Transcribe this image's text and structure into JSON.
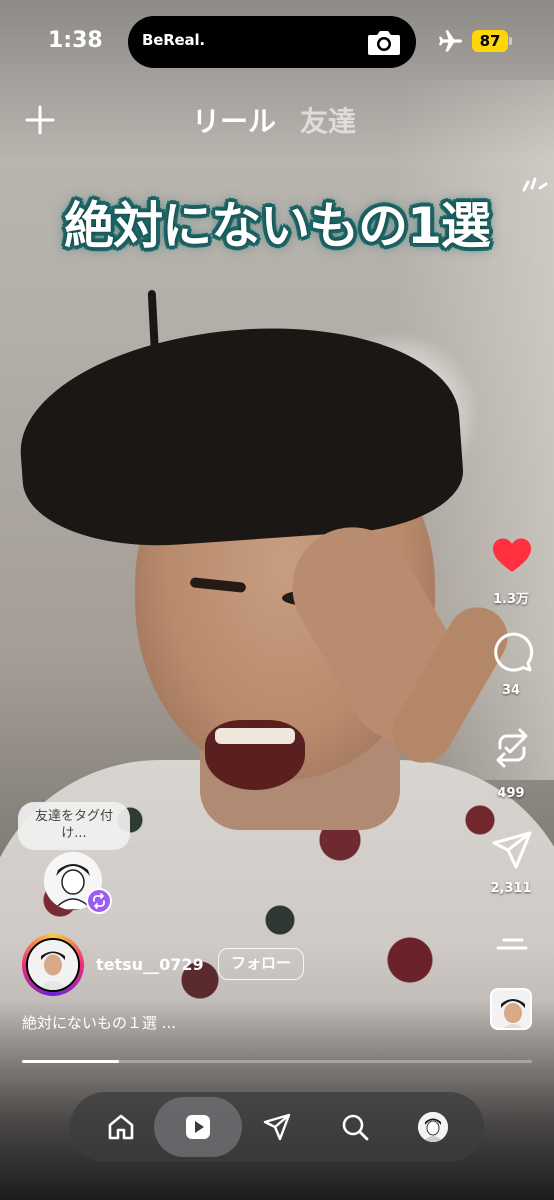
{
  "status_bar": {
    "time": "1:38",
    "island_app": "BeReal.",
    "battery": "87",
    "icons": [
      "camera-icon",
      "airplane-icon"
    ],
    "battery_color": "#ffd60a"
  },
  "header": {
    "tabs": [
      {
        "label": "リール",
        "active": true
      },
      {
        "label": "友達",
        "active": false
      }
    ],
    "add_icon": "plus-icon"
  },
  "video": {
    "overlay_caption": "絶対にないもの1選"
  },
  "actions": {
    "like_count": "1.3万",
    "comment_count": "34",
    "repost_count": "499",
    "share_count": "2,311",
    "like_color": "#ff3040"
  },
  "tag": {
    "prompt": "友達をタグ付け..."
  },
  "author": {
    "username": "tetsu__0729",
    "follow_label": "フォロー",
    "description": "絶対にないもの１選 ..."
  },
  "playback": {
    "progress": 0.19
  },
  "nav": {
    "items": [
      "home-icon",
      "reels-icon",
      "send-icon",
      "search-icon",
      "profile-avatar"
    ],
    "active": "reels-icon"
  }
}
